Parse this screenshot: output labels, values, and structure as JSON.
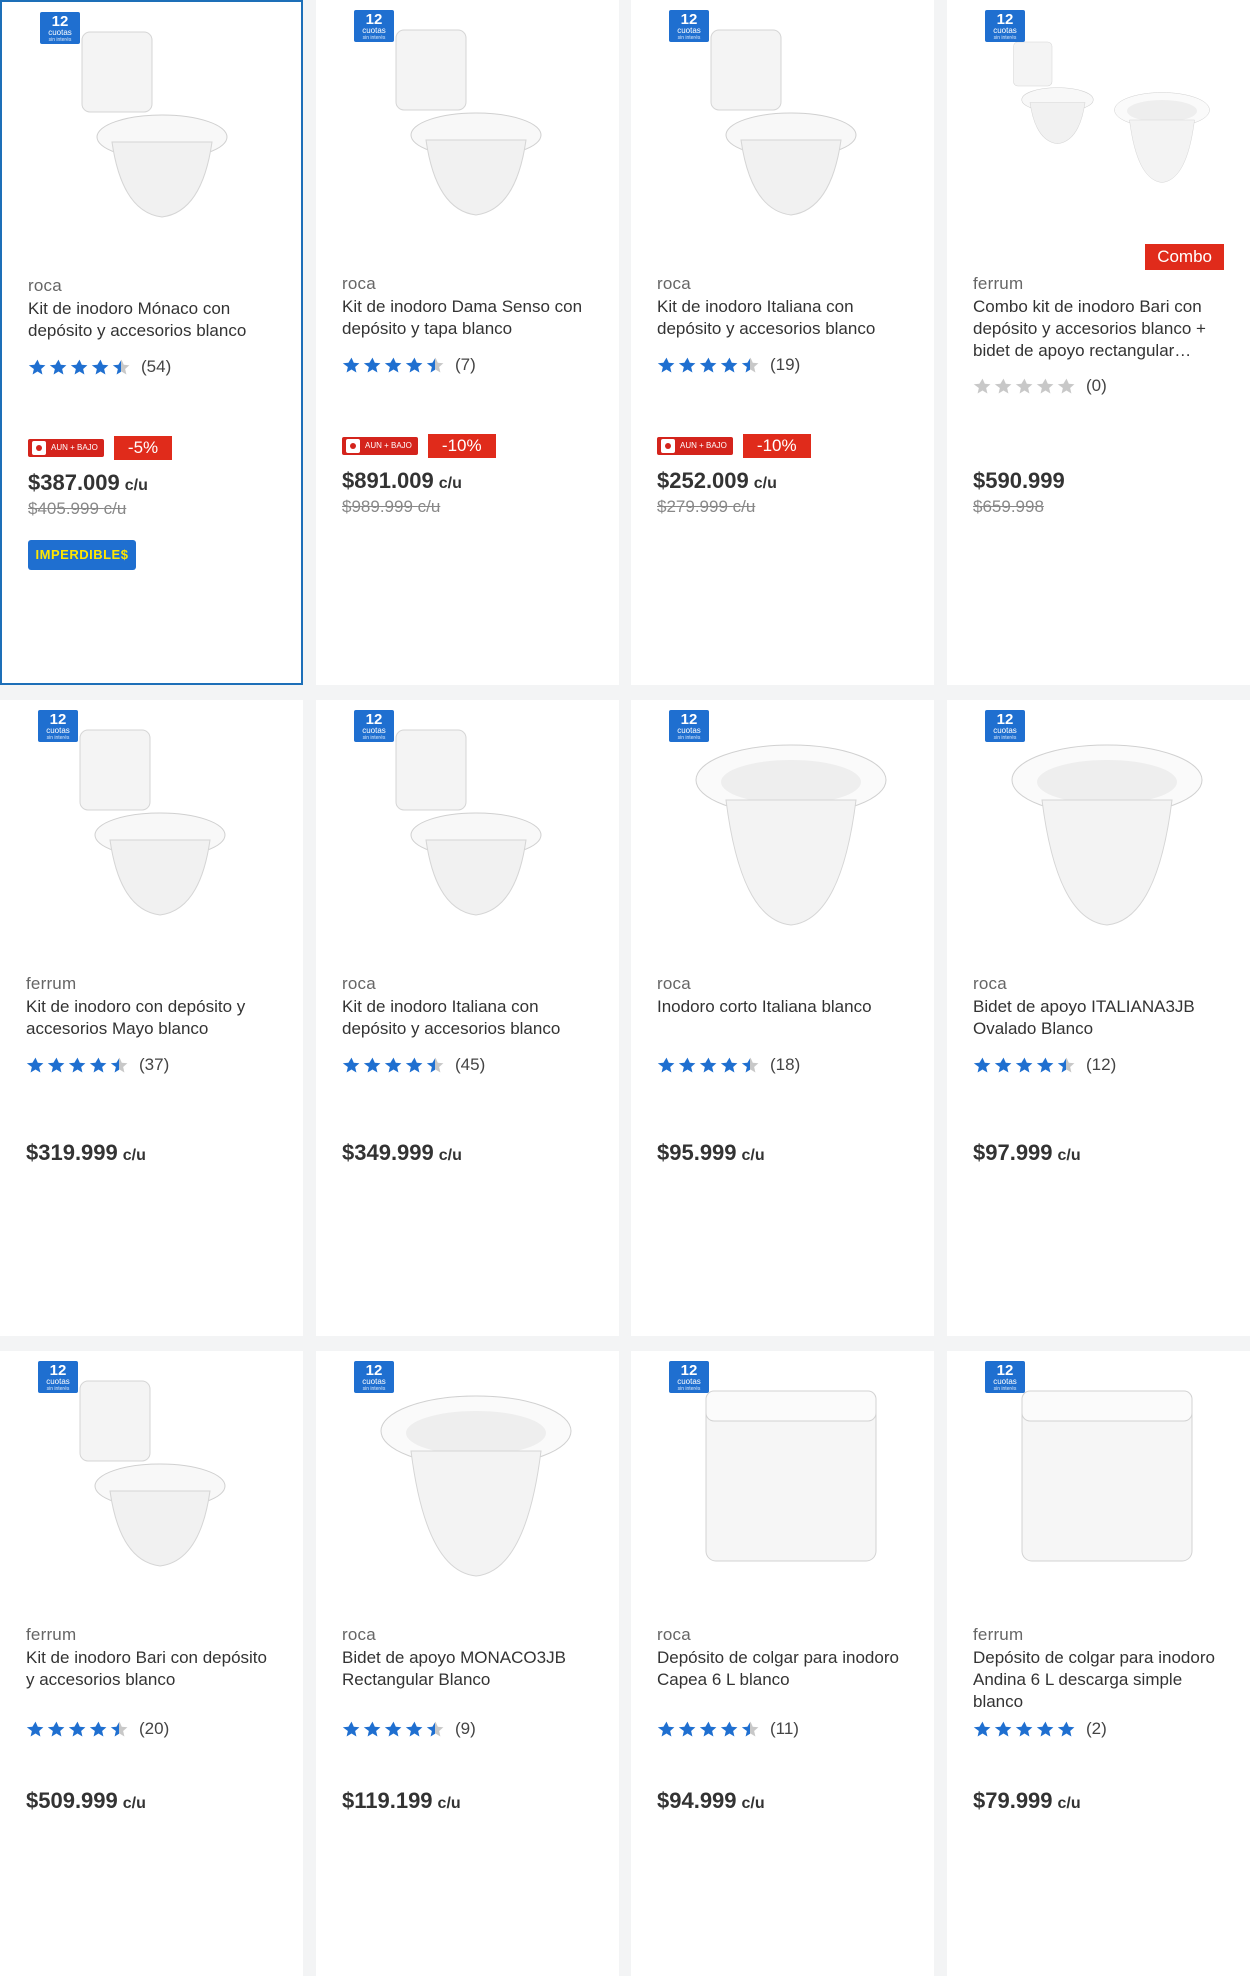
{
  "installments_badge": {
    "number": "12",
    "line1": "cuotas",
    "line2": "sin interés"
  },
  "promo_badge_label": "AUN + BAJO",
  "unit_suffix": "c/u",
  "products": [
    {
      "brand": "roca",
      "title": "Kit de inodoro Mónaco con depósito y accesorios blanco",
      "rating": 4.5,
      "reviews": "(54)",
      "discount": "-5%",
      "price": "$387.009",
      "old_price": "$405.999",
      "old_suffix": "c/u",
      "tag": "IMPERDIBLE$",
      "promo": true
    },
    {
      "brand": "roca",
      "title": "Kit de inodoro Dama Senso con depósito y tapa blanco",
      "rating": 4.5,
      "reviews": "(7)",
      "discount": "-10%",
      "price": "$891.009",
      "old_price": "$989.999",
      "old_suffix": "c/u",
      "promo": true
    },
    {
      "brand": "roca",
      "title": "Kit de inodoro Italiana con depósito y accesorios blanco",
      "rating": 4.5,
      "reviews": "(19)",
      "discount": "-10%",
      "price": "$252.009",
      "old_price": "$279.999",
      "old_suffix": "c/u",
      "promo": true
    },
    {
      "brand": "ferrum",
      "title": "Combo kit de inodoro Bari con depósito y accesorios blanco + bidet de apoyo rectangular…",
      "rating": 0,
      "reviews": "(0)",
      "price": "$590.999",
      "old_price": "$659.998",
      "combo": "Combo"
    },
    {
      "brand": "ferrum",
      "title": "Kit de inodoro con depósito y accesorios Mayo blanco",
      "rating": 4.5,
      "reviews": "(37)",
      "price": "$319.999"
    },
    {
      "brand": "roca",
      "title": "Kit de inodoro Italiana con depósito y accesorios blanco",
      "rating": 4.5,
      "reviews": "(45)",
      "price": "$349.999"
    },
    {
      "brand": "roca",
      "title": "Inodoro corto Italiana blanco",
      "rating": 4.5,
      "reviews": "(18)",
      "price": "$95.999"
    },
    {
      "brand": "roca",
      "title": "Bidet de apoyo ITALIANA3JB Ovalado Blanco",
      "rating": 4.5,
      "reviews": "(12)",
      "price": "$97.999"
    },
    {
      "brand": "ferrum",
      "title": "Kit de inodoro Bari con depósito y accesorios blanco",
      "rating": 4.5,
      "reviews": "(20)",
      "price": "$509.999"
    },
    {
      "brand": "roca",
      "title": "Bidet de apoyo MONACO3JB Rectangular Blanco",
      "rating": 4.5,
      "reviews": "(9)",
      "price": "$119.199"
    },
    {
      "brand": "roca",
      "title": "Depósito de colgar para inodoro Capea 6 L blanco",
      "rating": 4.5,
      "reviews": "(11)",
      "price": "$94.999"
    },
    {
      "brand": "ferrum",
      "title": "Depósito de colgar para inodoro Andina 6 L descarga simple blanco",
      "rating": 5,
      "reviews": "(2)",
      "price": "$79.999"
    }
  ],
  "colors": {
    "star": "#1f6fd0",
    "star_empty": "#c8c8c8",
    "discount": "#e02b1b",
    "accent": "#1f6fd0"
  }
}
